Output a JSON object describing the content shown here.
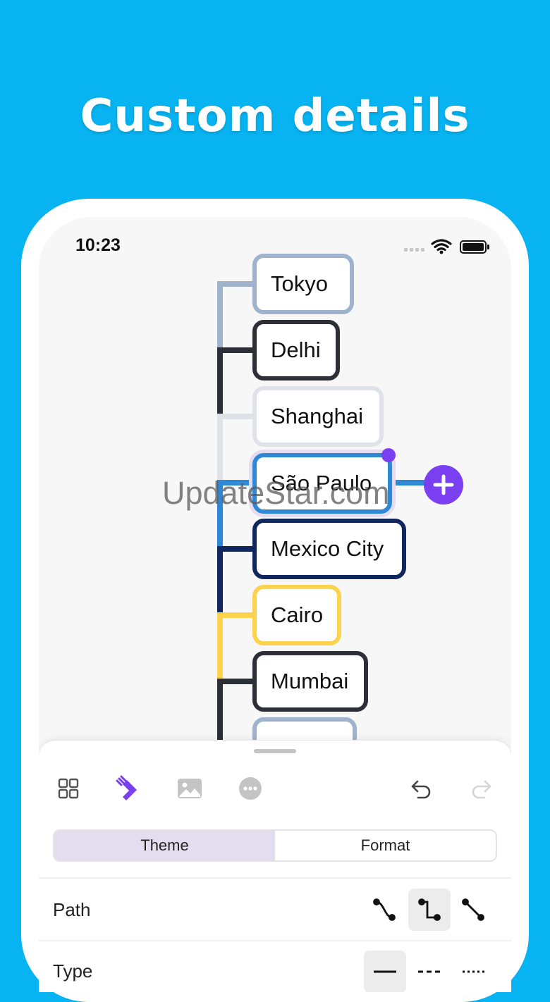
{
  "headline": "Custom details",
  "status": {
    "time": "10:23"
  },
  "mindmap": {
    "nodes": [
      {
        "label": "Tokyo",
        "color": "#9fb3cc"
      },
      {
        "label": "Delhi",
        "color": "#2c2f36"
      },
      {
        "label": "Shanghai",
        "color": "#dfe3e8"
      },
      {
        "label": "São Paulo",
        "color": "#2f88d6"
      },
      {
        "label": "Mexico City",
        "color": "#10275e"
      },
      {
        "label": "Cairo",
        "color": "#fcd34d"
      },
      {
        "label": "Mumbai",
        "color": "#2c2f36"
      }
    ],
    "selected_index": 3,
    "accent": "#7b3ff2"
  },
  "watermark": "UpdateStar.com",
  "panel": {
    "tools": [
      "grid-icon",
      "brush-icon",
      "image-icon",
      "more-icon",
      "undo-icon",
      "redo-icon"
    ],
    "tabs": [
      {
        "label": "Theme",
        "active": true
      },
      {
        "label": "Format",
        "active": false
      }
    ],
    "rows": [
      {
        "label": "Path",
        "options": [
          "curve",
          "elbow",
          "straight"
        ],
        "selected": 1
      },
      {
        "label": "Type",
        "options": [
          "solid",
          "dashed",
          "dotted"
        ],
        "selected": 0
      }
    ]
  }
}
